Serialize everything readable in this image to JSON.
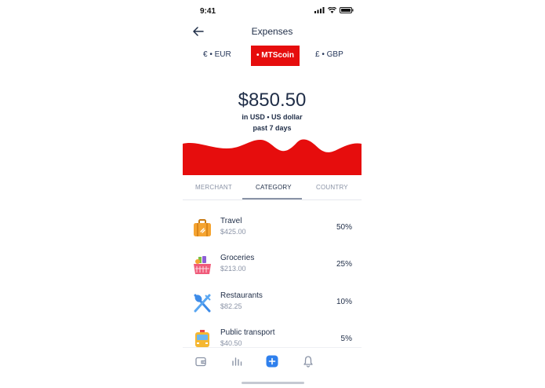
{
  "status": {
    "time": "9:41"
  },
  "header": {
    "title": "Expenses"
  },
  "currencies": [
    {
      "label": "€ • EUR"
    },
    {
      "label": "• MTScoin",
      "active": true
    },
    {
      "label": "£ • GBP"
    }
  ],
  "summary": {
    "amount": "$850.50",
    "unit": "in USD • US dollar",
    "period": "past 7 days"
  },
  "tabs": [
    {
      "label": "MERCHANT"
    },
    {
      "label": "CATEGORY",
      "active": true
    },
    {
      "label": "COUNTRY"
    }
  ],
  "categories": [
    {
      "icon": "suitcase-icon",
      "name": "Travel",
      "amount": "$425.00",
      "percent": "50%"
    },
    {
      "icon": "basket-icon",
      "name": "Groceries",
      "amount": "$213.00",
      "percent": "25%"
    },
    {
      "icon": "utensils-icon",
      "name": "Restaurants",
      "amount": "$82.25",
      "percent": "10%"
    },
    {
      "icon": "bus-icon",
      "name": "Public transport",
      "amount": "$40.50",
      "percent": "5%"
    }
  ],
  "tabbar": [
    {
      "icon": "wallet-icon"
    },
    {
      "icon": "chart-icon"
    },
    {
      "icon": "add-icon"
    },
    {
      "icon": "bell-icon"
    }
  ],
  "colors": {
    "accent": "#e60d0d",
    "primary": "#1f2d47",
    "muted": "#8a93a6",
    "fab": "#2f80ed"
  }
}
